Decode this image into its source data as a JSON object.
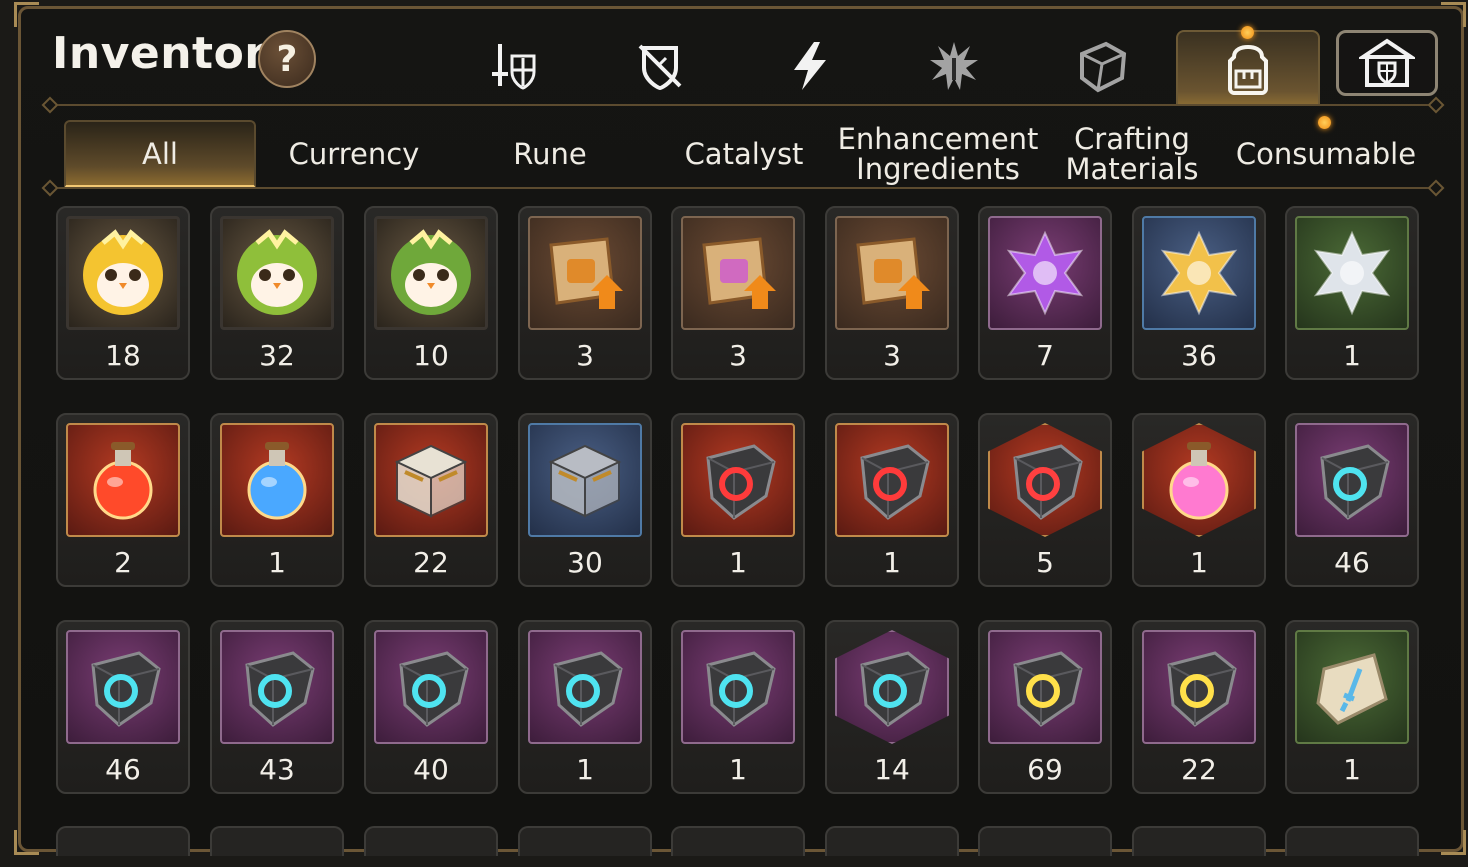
{
  "header": {
    "title": "Inventory",
    "help_label": "?"
  },
  "top_tabs": [
    {
      "icon": "sword-shield-icon",
      "active": false
    },
    {
      "icon": "shield-off-icon",
      "active": false
    },
    {
      "icon": "lightning-icon",
      "active": false
    },
    {
      "icon": "burst-icon",
      "active": false
    },
    {
      "icon": "cube-icon",
      "active": false
    },
    {
      "icon": "backpack-icon",
      "active": true,
      "notification": true
    },
    {
      "icon": "guild-hall-icon",
      "active": false
    }
  ],
  "category_tabs": [
    {
      "label": "All",
      "active": true
    },
    {
      "label": "Currency"
    },
    {
      "label": "Rune"
    },
    {
      "label": "Catalyst"
    },
    {
      "label": "Enhancement\nIngredients"
    },
    {
      "label": "Crafting\nMaterials"
    },
    {
      "label": "Consumable",
      "notification": true
    }
  ],
  "items": [
    {
      "icon": "golden-chick-token-icon",
      "count": "18"
    },
    {
      "icon": "green-chick-token-icon",
      "count": "32"
    },
    {
      "icon": "leaf-chick-token-icon",
      "count": "10"
    },
    {
      "icon": "dragon-scroll-upgrade-icon",
      "count": "3"
    },
    {
      "icon": "rainbow-scroll-upgrade-icon",
      "count": "3"
    },
    {
      "icon": "rune-scroll-upgrade-icon",
      "count": "3"
    },
    {
      "icon": "purple-crystal-flower-icon",
      "count": "7"
    },
    {
      "icon": "gold-crystal-flower-icon",
      "count": "36"
    },
    {
      "icon": "silver-crystal-flower-icon",
      "count": "1"
    },
    {
      "icon": "red-potion-icon",
      "count": "2"
    },
    {
      "icon": "star-potion-icon",
      "count": "1"
    },
    {
      "icon": "gold-chest-icon",
      "count": "22"
    },
    {
      "icon": "silver-chest-icon",
      "count": "30"
    },
    {
      "icon": "red-ring-stone-icon",
      "count": "1"
    },
    {
      "icon": "red-necklace-stone-icon",
      "count": "1"
    },
    {
      "icon": "red-star-stone-icon",
      "count": "5"
    },
    {
      "icon": "pink-potion-icon",
      "count": "1"
    },
    {
      "icon": "weapon-stone-icon",
      "count": "46"
    },
    {
      "icon": "helmet-stone-icon",
      "count": "46"
    },
    {
      "icon": "armor-stone-icon",
      "count": "43"
    },
    {
      "icon": "boots-stone-icon",
      "count": "40"
    },
    {
      "icon": "ring-stone-icon",
      "count": "1"
    },
    {
      "icon": "necklace-stone-icon",
      "count": "1"
    },
    {
      "icon": "star-stone-icon",
      "count": "14"
    },
    {
      "icon": "hammer-stone-icon",
      "count": "69"
    },
    {
      "icon": "lightning-stone-icon",
      "count": "22"
    },
    {
      "icon": "weapon-tablet-icon",
      "count": "1"
    }
  ],
  "colors": {
    "accent_gold": "#f3c873",
    "frame": "#6b5636",
    "notification": "#f59a1c"
  }
}
